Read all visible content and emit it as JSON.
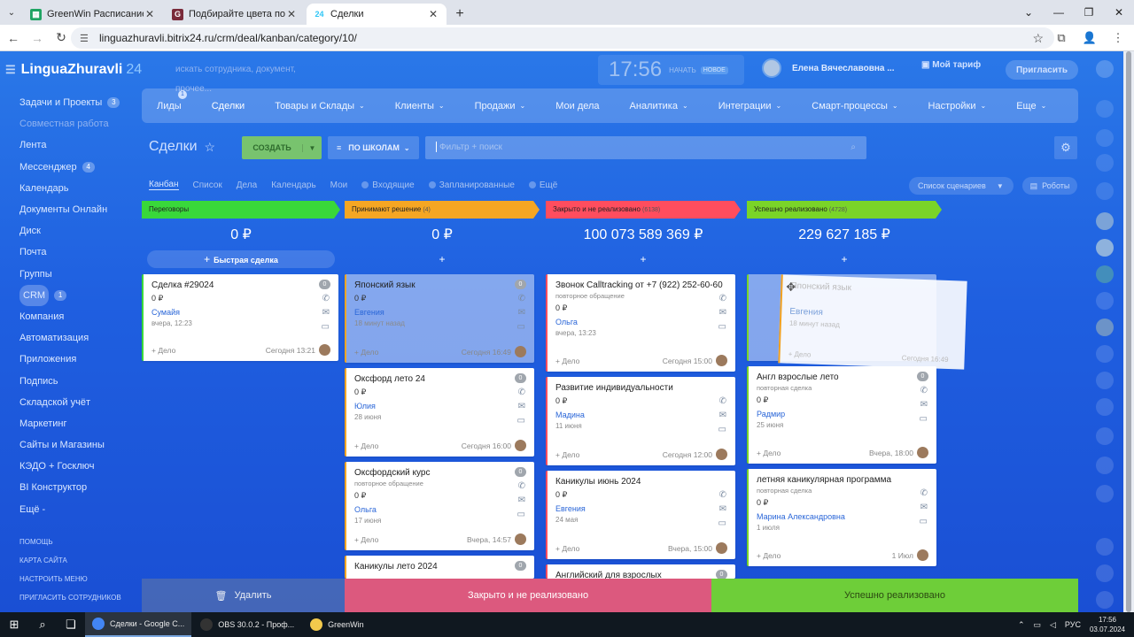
{
  "browser": {
    "tabs": [
      {
        "title": "GreenWin Расписание - Goog",
        "fav_color": "#1fa463",
        "fav": "▦",
        "active": false
      },
      {
        "title": "Подбирайте цвета по фотогр",
        "fav_color": "#7a2a3a",
        "fav": "G",
        "active": false
      },
      {
        "title": "Сделки",
        "fav_color": "#2fc6f6",
        "fav": "24",
        "active": true
      }
    ],
    "url": "linguazhuravli.bitrix24.ru/crm/deal/kanban/category/10/"
  },
  "app": {
    "logo": "LinguaZhuravli",
    "logo_num": "24",
    "top_search_placeholder": "искать сотрудника, документ, прочее...",
    "clock_time": "17:56",
    "clock_start": "НАЧАТЬ",
    "clock_new": "НОВОЕ",
    "user_name": "Елена Вячеславовна ...",
    "tariff": "Мой тариф",
    "invite": "Пригласить"
  },
  "sidebar": {
    "items": [
      {
        "label": "Задачи и Проекты",
        "badge": "3",
        "dim": false,
        "sel": false
      },
      {
        "label": "Совместная работа",
        "badge": "",
        "dim": true,
        "sel": false
      },
      {
        "label": "Лента",
        "badge": "",
        "dim": false,
        "sel": false
      },
      {
        "label": "Мессенджер",
        "badge": "4",
        "dim": false,
        "sel": false
      },
      {
        "label": "Календарь",
        "badge": "",
        "dim": false,
        "sel": false
      },
      {
        "label": "Документы Онлайн",
        "badge": "",
        "dim": false,
        "sel": false
      },
      {
        "label": "Диск",
        "badge": "",
        "dim": false,
        "sel": false
      },
      {
        "label": "Почта",
        "badge": "",
        "dim": false,
        "sel": false
      },
      {
        "label": "Группы",
        "badge": "",
        "dim": false,
        "sel": false
      },
      {
        "label": "CRM",
        "badge": "1",
        "dim": false,
        "sel": true
      },
      {
        "label": "Компания",
        "badge": "",
        "dim": false,
        "sel": false
      },
      {
        "label": "Автоматизация",
        "badge": "",
        "dim": false,
        "sel": false
      },
      {
        "label": "Приложения",
        "badge": "",
        "dim": false,
        "sel": false
      },
      {
        "label": "Подпись",
        "badge": "",
        "dim": false,
        "sel": false
      },
      {
        "label": "Складской учёт",
        "badge": "",
        "dim": false,
        "sel": false
      },
      {
        "label": "Маркетинг",
        "badge": "",
        "dim": false,
        "sel": false
      },
      {
        "label": "Сайты и Магазины",
        "badge": "",
        "dim": false,
        "sel": false
      },
      {
        "label": "КЭДО + Госключ",
        "badge": "",
        "dim": false,
        "sel": false
      },
      {
        "label": "BI Конструктор",
        "badge": "",
        "dim": false,
        "sel": false
      },
      {
        "label": "Ещё -",
        "badge": "",
        "dim": false,
        "sel": false
      }
    ],
    "footer": [
      "ПОМОЩЬ",
      "КАРТА САЙТА",
      "НАСТРОИТЬ МЕНЮ",
      "ПРИГЛАСИТЬ СОТРУДНИКОВ"
    ]
  },
  "nav": {
    "items": [
      {
        "label": "Лиды",
        "chev": false,
        "badge": "1",
        "sel": false
      },
      {
        "label": "Сделки",
        "chev": false,
        "badge": "",
        "sel": true
      },
      {
        "label": "Товары и Склады",
        "chev": true,
        "badge": "",
        "sel": false
      },
      {
        "label": "Клиенты",
        "chev": true,
        "badge": "",
        "sel": false
      },
      {
        "label": "Продажи",
        "chev": true,
        "badge": "",
        "sel": false
      },
      {
        "label": "Мои дела",
        "chev": false,
        "badge": "",
        "sel": false
      },
      {
        "label": "Аналитика",
        "chev": true,
        "badge": "",
        "sel": false
      },
      {
        "label": "Интеграции",
        "chev": true,
        "badge": "",
        "sel": false
      },
      {
        "label": "Смарт-процессы",
        "chev": true,
        "badge": "",
        "sel": false
      },
      {
        "label": "Настройки",
        "chev": true,
        "badge": "",
        "sel": false
      },
      {
        "label": "Еще",
        "chev": true,
        "badge": "",
        "sel": false
      }
    ]
  },
  "toolbar": {
    "title": "Сделки",
    "create": "СОЗДАТЬ",
    "schools": "ПО ШКОЛАМ",
    "filter_placeholder": "Фильтр + поиск",
    "views": [
      "Канбан",
      "Список",
      "Дела",
      "Календарь"
    ],
    "mine": "Мои",
    "mine_opts": [
      "Входящие",
      "Запланированные",
      "Ещё"
    ],
    "scenarios": "Список сценариев",
    "robots": "Роботы"
  },
  "columns": [
    {
      "stage": "Переговоры",
      "count": "",
      "color": "#39d83a",
      "total": "0 ₽",
      "quick": "Быстрая сделка",
      "cards": [
        {
          "title": "Сделка #29024",
          "sub": "",
          "sum": "0 ₽",
          "who": "Сумайя",
          "when": "вчера, 12:23",
          "date": "Сегодня 13:21",
          "badge": "0",
          "ghost": false
        }
      ]
    },
    {
      "stage": "Принимают решение",
      "count": "(4)",
      "color": "#f5a623",
      "total": "0 ₽",
      "quick": "",
      "cards": [
        {
          "title": "Японский язык",
          "sub": "",
          "sum": "0 ₽",
          "who": "Евгения",
          "when": "18 минут назад",
          "date": "Сегодня 16:49",
          "badge": "0",
          "ghost": true
        },
        {
          "title": "Оксфорд лето 24",
          "sub": "",
          "sum": "0 ₽",
          "who": "Юлия",
          "when": "28 июня",
          "date": "Сегодня 16:00",
          "badge": "0",
          "ghost": false
        },
        {
          "title": "Оксфордский курс",
          "sub": "повторное обращение",
          "sum": "0 ₽",
          "who": "Ольга",
          "when": "17 июня",
          "date": "Вчера, 14:57",
          "badge": "0",
          "ghost": false
        },
        {
          "title": "Каникулы лето 2024",
          "sub": "",
          "sum": "",
          "who": "",
          "when": "",
          "date": "",
          "badge": "0",
          "ghost": false
        }
      ]
    },
    {
      "stage": "Закрыто и не реализовано",
      "count": "(6138)",
      "color": "#ff4d5e",
      "total": "100 073 589 369 ₽",
      "quick": "",
      "cards": [
        {
          "title": "Звонок Calltracking от +7 (922) 252-60-60",
          "sub": "повторное обращение",
          "sum": "0 ₽",
          "who": "Ольга",
          "when": "вчера, 13:23",
          "date": "Сегодня 15:00",
          "badge": "",
          "ghost": false
        },
        {
          "title": "Развитие индивидуальности",
          "sub": "",
          "sum": "0 ₽",
          "who": "Мадина",
          "when": "11 июня",
          "date": "Сегодня 12:00",
          "badge": "",
          "ghost": false
        },
        {
          "title": "Каникулы июнь 2024",
          "sub": "",
          "sum": "0 ₽",
          "who": "Евгения",
          "when": "24 мая",
          "date": "Вчера, 15:00",
          "badge": "",
          "ghost": false
        },
        {
          "title": "Английский для взрослых",
          "sub": "",
          "sum": "",
          "who": "",
          "when": "",
          "date": "",
          "badge": "0",
          "ghost": false
        }
      ]
    },
    {
      "stage": "Успешно реализовано",
      "count": "(4728)",
      "color": "#7ad428",
      "total": "229 627 185 ₽",
      "quick": "",
      "cards": [
        {
          "title": "",
          "sub": "",
          "sum": "",
          "who": "",
          "when": "",
          "date": "",
          "badge": "",
          "ghost": true
        },
        {
          "title": "Англ взрослые лето",
          "sub": "повторная сделка",
          "sum": "0 ₽",
          "who": "Радмир",
          "when": "25 июня",
          "date": "Вчера, 18:00",
          "badge": "0",
          "ghost": false
        },
        {
          "title": "летняя каникулярная программа",
          "sub": "повторная сделка",
          "sum": "0 ₽",
          "who": "Марина Александровна",
          "when": "1 июля",
          "date": "1 Июл",
          "badge": "",
          "ghost": false
        }
      ]
    }
  ],
  "drag_card": {
    "title": "Японский язык",
    "who": "Евгения",
    "when": "18 минут назад",
    "date": "Сегодня 16:49",
    "add": "+ Дело"
  },
  "card_add": "+ Дело",
  "actions": {
    "delete": "Удалить",
    "lost": "Закрыто и не реализовано",
    "won": "Успешно реализовано"
  },
  "taskbar": {
    "apps": [
      {
        "label": "Сделки - Google C...",
        "color": "#4285f4",
        "active": true
      },
      {
        "label": "OBS 30.0.2 - Проф...",
        "color": "#333333",
        "active": false
      },
      {
        "label": "GreenWin",
        "color": "#f2c94c",
        "active": false
      }
    ],
    "lang": "РУС",
    "time": "17:56",
    "date": "03.07.2024"
  }
}
